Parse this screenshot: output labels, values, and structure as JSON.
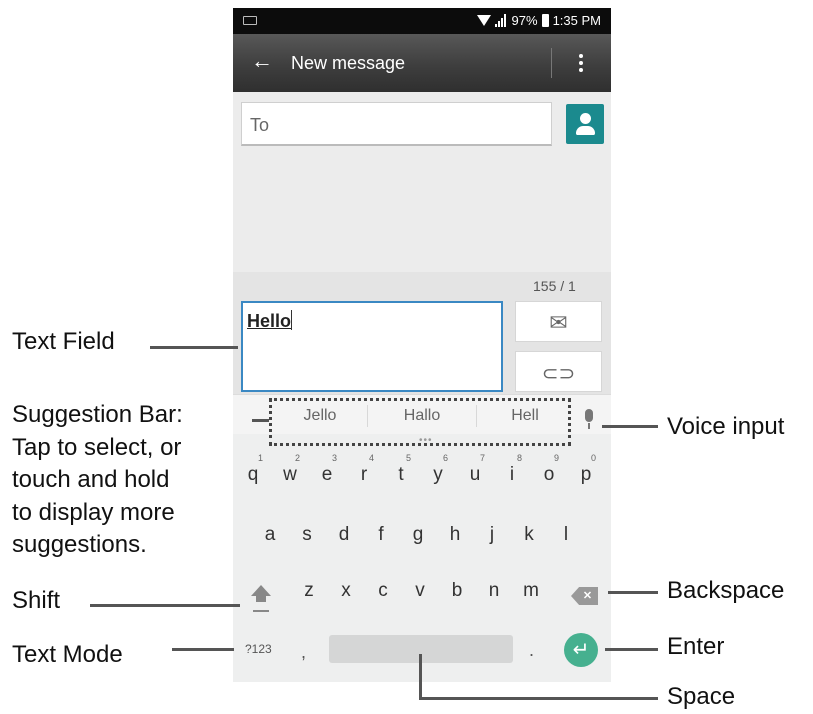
{
  "status_bar": {
    "battery": "97%",
    "time": "1:35 PM"
  },
  "action_bar": {
    "back_icon": "arrow-left-icon",
    "title": "New message",
    "overflow_icon": "overflow-menu-icon"
  },
  "recipient": {
    "placeholder": "To",
    "contact_icon": "contact-icon"
  },
  "compose": {
    "counter": "155 / 1",
    "text": "Hello",
    "send_icon": "send-mms-icon",
    "attach_icon": "paperclip-icon"
  },
  "suggestions": [
    "Jello",
    "Hallo",
    "Hell"
  ],
  "keyboard": {
    "row1": [
      "q",
      "w",
      "e",
      "r",
      "t",
      "y",
      "u",
      "i",
      "o",
      "p"
    ],
    "row1_hints": [
      "1",
      "2",
      "3",
      "4",
      "5",
      "6",
      "7",
      "8",
      "9",
      "0"
    ],
    "row2": [
      "a",
      "s",
      "d",
      "f",
      "g",
      "h",
      "j",
      "k",
      "l"
    ],
    "row3": [
      "z",
      "x",
      "c",
      "v",
      "b",
      "n",
      "m"
    ],
    "mode": "?123",
    "comma": ",",
    "period": ".",
    "enter_glyph": "↵",
    "backspace_glyph": "✕"
  },
  "callouts": {
    "text_field": "Text Field",
    "suggestion_bar": [
      "Suggestion Bar:",
      "Tap to select, or",
      "touch and hold",
      "to display more",
      "suggestions."
    ],
    "shift": "Shift",
    "text_mode": "Text Mode",
    "voice_input": "Voice input",
    "backspace": "Backspace",
    "enter": "Enter",
    "space": "Space"
  }
}
